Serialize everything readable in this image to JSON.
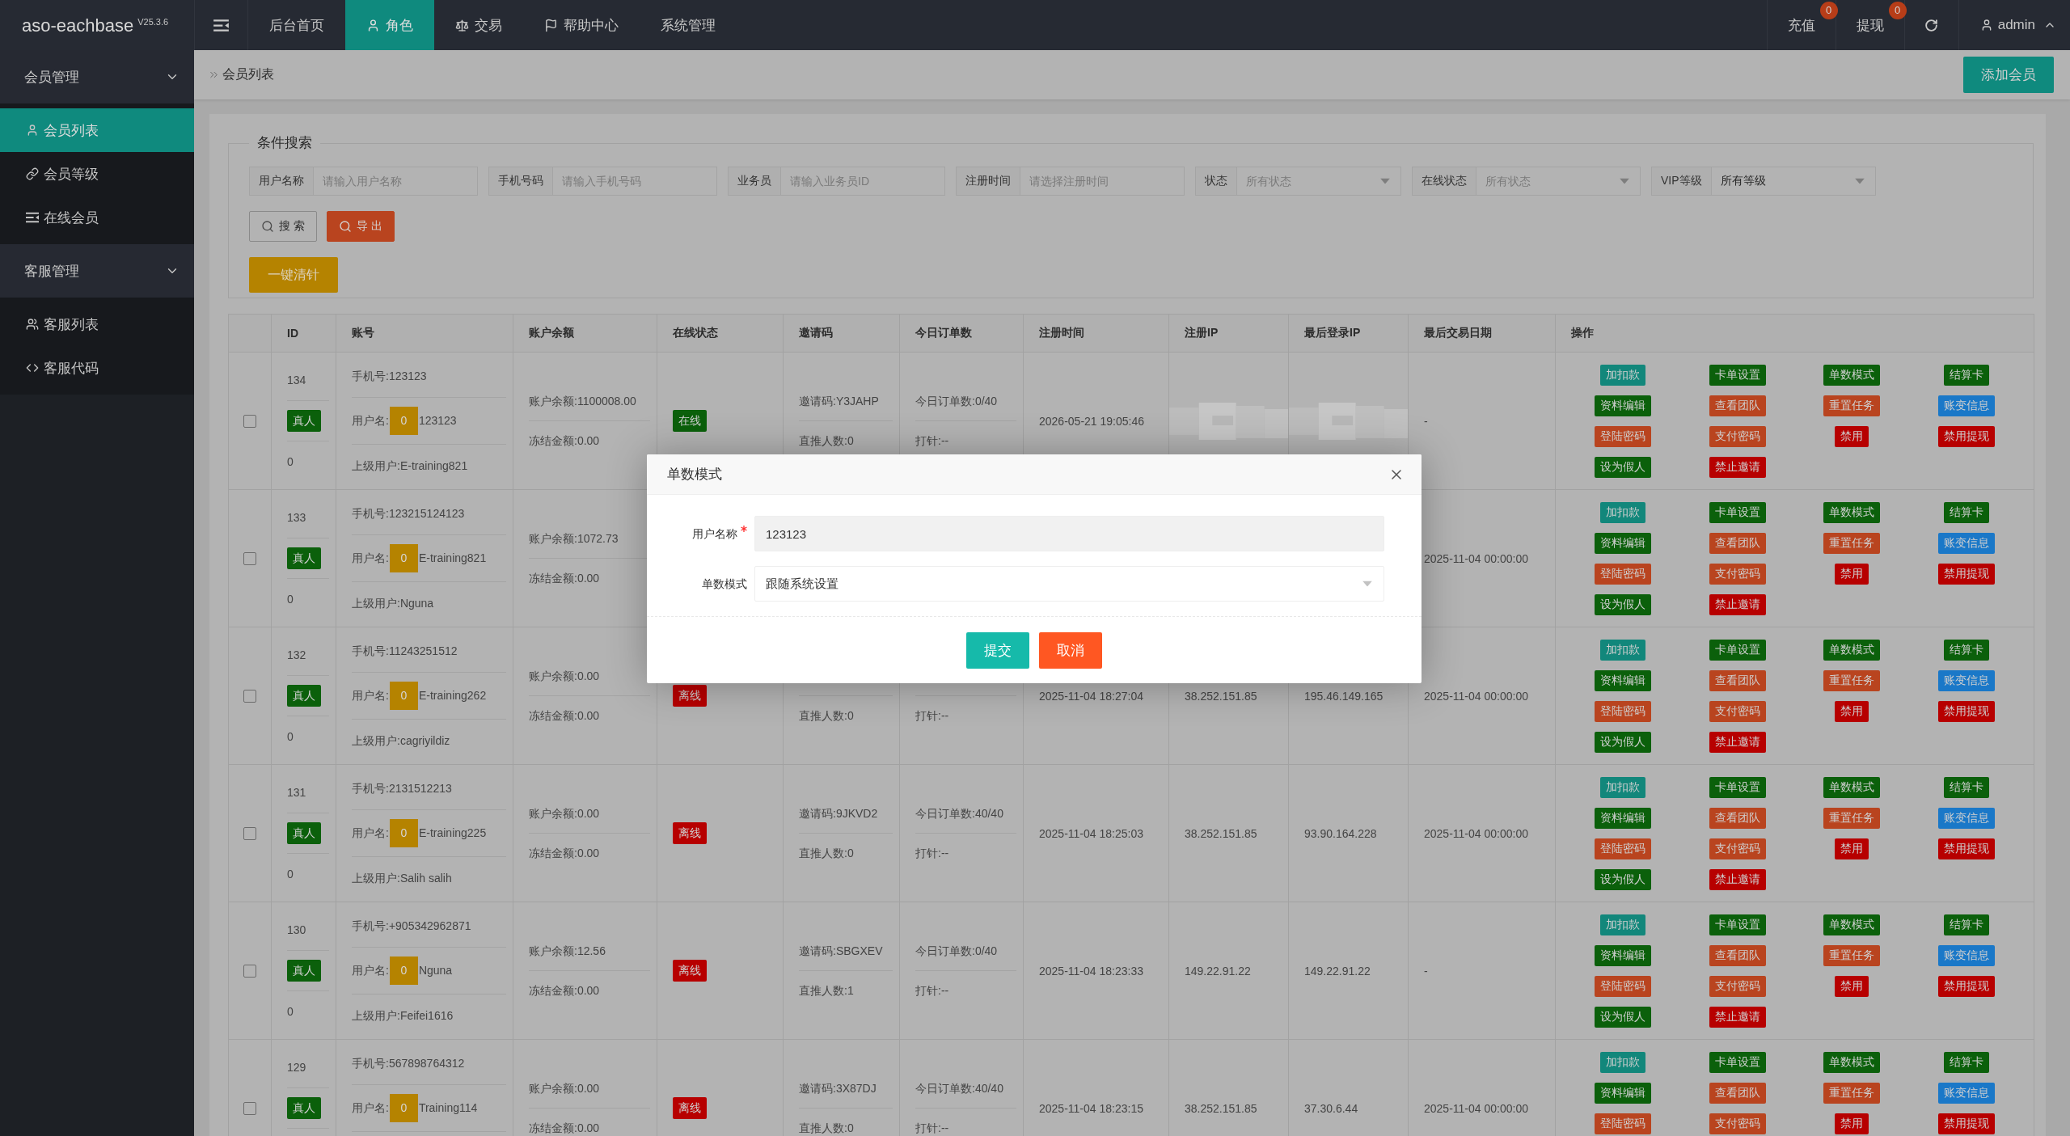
{
  "header": {
    "logo": "aso-eachbase",
    "version": "V25.3.6",
    "nav": [
      {
        "label": "后台首页",
        "selected": false
      },
      {
        "label": "角色",
        "selected": true
      },
      {
        "label": "交易",
        "selected": false
      },
      {
        "label": "帮助中心",
        "selected": false
      },
      {
        "label": "系统管理",
        "selected": false
      }
    ],
    "shortcuts": [
      {
        "label": "充值",
        "badge": "0"
      },
      {
        "label": "提现",
        "badge": "0"
      }
    ],
    "user": "admin"
  },
  "sidebar": {
    "groups": [
      {
        "label": "会员管理",
        "expanded": true,
        "children": [
          {
            "label": "会员列表",
            "selected": true
          },
          {
            "label": "会员等级",
            "selected": false
          },
          {
            "label": "在线会员",
            "selected": false
          }
        ]
      },
      {
        "label": "客服管理",
        "expanded": true,
        "children": [
          {
            "label": "客服列表",
            "selected": false
          },
          {
            "label": "客服代码",
            "selected": false
          }
        ]
      }
    ]
  },
  "breadcrumb": {
    "items": [
      "会员列表"
    ],
    "add_button": "添加会员"
  },
  "search": {
    "legend": "条件搜索",
    "fields": [
      {
        "label": "用户名称",
        "kind": "text",
        "placeholder": "请输入用户名称"
      },
      {
        "label": "手机号码",
        "kind": "text",
        "placeholder": "请输入手机号码"
      },
      {
        "label": "业务员",
        "kind": "text",
        "placeholder": "请输入业务员ID"
      },
      {
        "label": "注册时间",
        "kind": "text",
        "placeholder": "请选择注册时间"
      },
      {
        "label": "状态",
        "kind": "select",
        "placeholder": "所有状态"
      },
      {
        "label": "在线状态",
        "kind": "select",
        "placeholder": "所有状态"
      },
      {
        "label": "VIP等级",
        "kind": "select",
        "value": "所有等级"
      }
    ],
    "buttons": [
      {
        "label": "搜 索",
        "kind": "outline"
      },
      {
        "label": "导 出",
        "kind": "export"
      }
    ],
    "clear_button": "一键清针"
  },
  "table": {
    "columns": [
      "ID",
      "账号",
      "账户余额",
      "在线状态",
      "邀请码",
      "今日订单数",
      "注册时间",
      "注册IP",
      "最后登录IP",
      "最后交易日期",
      "操作"
    ],
    "rows": [
      {
        "checked": false,
        "id": "134",
        "type_tag": "真人",
        "id_sub": "0",
        "phone": "手机号:123123",
        "username_label": "用户名:",
        "username_badge": "0",
        "username": "123123",
        "parent": "上级用户:E-training821",
        "balance": "账户余额:1100008.00",
        "frozen": "冻结金额:0.00",
        "status": {
          "label": "在线",
          "online": true
        },
        "invite": "邀请码:Y3JAHP",
        "direct": "直推人数:0",
        "orders": "今日订单数:0/40",
        "dazhen": "打针:--",
        "reg_time": "2026-05-21 19:05:46",
        "ips_blurred": true,
        "last_trade": "-",
        "actions": [
          {
            "label": "加扣款",
            "color": "#12877b"
          },
          {
            "label": "卡单设置",
            "color": "#0b600b"
          },
          {
            "label": "单数模式",
            "color": "#0b600b"
          },
          {
            "label": "结算卡",
            "color": "#0b600b"
          },
          {
            "label": "资料编辑",
            "color": "#0b600b"
          },
          {
            "label": "查看团队",
            "color": "#b9441f"
          },
          {
            "label": "重置任务",
            "color": "#b9441f"
          },
          {
            "label": "账变信息",
            "color": "#1a78c8"
          },
          {
            "label": "登陆密码",
            "color": "#b9441f"
          },
          {
            "label": "支付密码",
            "color": "#b9441f"
          },
          {
            "label": "禁用",
            "color": "#b70000"
          },
          {
            "label": "禁用提现",
            "color": "#b70000"
          },
          {
            "label": "设为假人",
            "color": "#0b600b"
          },
          {
            "label": "禁止邀请",
            "color": "#b70000"
          }
        ]
      },
      {
        "checked": false,
        "id": "133",
        "type_tag": "真人",
        "id_sub": "0",
        "phone": "手机号:123215124123",
        "username_label": "用户名:",
        "username_badge": "0",
        "username": "E-training821",
        "parent": "上级用户:Nguna",
        "balance": "账户余额:1072.73",
        "frozen": "冻结金额:0.00",
        "last_trade": "2025-11-04 00:00:00",
        "actions": [
          {
            "label": "加扣款",
            "color": "#12877b"
          },
          {
            "label": "卡单设置",
            "color": "#0b600b"
          },
          {
            "label": "单数模式",
            "color": "#0b600b"
          },
          {
            "label": "结算卡",
            "color": "#0b600b"
          },
          {
            "label": "资料编辑",
            "color": "#0b600b"
          },
          {
            "label": "查看团队",
            "color": "#b9441f"
          },
          {
            "label": "重置任务",
            "color": "#b9441f"
          },
          {
            "label": "账变信息",
            "color": "#1a78c8"
          },
          {
            "label": "登陆密码",
            "color": "#b9441f"
          },
          {
            "label": "支付密码",
            "color": "#b9441f"
          },
          {
            "label": "禁用",
            "color": "#b70000"
          },
          {
            "label": "禁用提现",
            "color": "#b70000"
          },
          {
            "label": "设为假人",
            "color": "#0b600b"
          },
          {
            "label": "禁止邀请",
            "color": "#b70000"
          }
        ]
      },
      {
        "checked": false,
        "id": "132",
        "type_tag": "真人",
        "id_sub": "0",
        "phone": "手机号:11243251512",
        "username_label": "用户名:",
        "username_badge": "0",
        "username": "E-training262",
        "parent": "上级用户:cagriyildiz",
        "balance": "账户余额:0.00",
        "frozen": "冻结金额:0.00",
        "status": {
          "label": "离线",
          "online": false
        },
        "direct": "直推人数:0",
        "dazhen": "打针:--",
        "reg_time": "2025-11-04 18:27:04",
        "reg_ip": "38.252.151.85",
        "last_ip": "195.46.149.165",
        "last_trade": "2025-11-04 00:00:00",
        "actions": [
          {
            "label": "加扣款",
            "color": "#12877b"
          },
          {
            "label": "卡单设置",
            "color": "#0b600b"
          },
          {
            "label": "单数模式",
            "color": "#0b600b"
          },
          {
            "label": "结算卡",
            "color": "#0b600b"
          },
          {
            "label": "资料编辑",
            "color": "#0b600b"
          },
          {
            "label": "查看团队",
            "color": "#b9441f"
          },
          {
            "label": "重置任务",
            "color": "#b9441f"
          },
          {
            "label": "账变信息",
            "color": "#1a78c8"
          },
          {
            "label": "登陆密码",
            "color": "#b9441f"
          },
          {
            "label": "支付密码",
            "color": "#b9441f"
          },
          {
            "label": "禁用",
            "color": "#b70000"
          },
          {
            "label": "禁用提现",
            "color": "#b70000"
          },
          {
            "label": "设为假人",
            "color": "#0b600b"
          },
          {
            "label": "禁止邀请",
            "color": "#b70000"
          }
        ]
      },
      {
        "checked": false,
        "id": "131",
        "type_tag": "真人",
        "id_sub": "0",
        "phone": "手机号:2131512213",
        "username_label": "用户名:",
        "username_badge": "0",
        "username": "E-training225",
        "parent": "上级用户:Salih salih",
        "balance": "账户余额:0.00",
        "frozen": "冻结金额:0.00",
        "status": {
          "label": "离线",
          "online": false
        },
        "invite": "邀请码:9JKVD2",
        "direct": "直推人数:0",
        "orders": "今日订单数:40/40",
        "dazhen": "打针:--",
        "reg_time": "2025-11-04 18:25:03",
        "reg_ip": "38.252.151.85",
        "last_ip": "93.90.164.228",
        "last_trade": "2025-11-04 00:00:00",
        "actions": [
          {
            "label": "加扣款",
            "color": "#12877b"
          },
          {
            "label": "卡单设置",
            "color": "#0b600b"
          },
          {
            "label": "单数模式",
            "color": "#0b600b"
          },
          {
            "label": "结算卡",
            "color": "#0b600b"
          },
          {
            "label": "资料编辑",
            "color": "#0b600b"
          },
          {
            "label": "查看团队",
            "color": "#b9441f"
          },
          {
            "label": "重置任务",
            "color": "#b9441f"
          },
          {
            "label": "账变信息",
            "color": "#1a78c8"
          },
          {
            "label": "登陆密码",
            "color": "#b9441f"
          },
          {
            "label": "支付密码",
            "color": "#b9441f"
          },
          {
            "label": "禁用",
            "color": "#b70000"
          },
          {
            "label": "禁用提现",
            "color": "#b70000"
          },
          {
            "label": "设为假人",
            "color": "#0b600b"
          },
          {
            "label": "禁止邀请",
            "color": "#b70000"
          }
        ]
      },
      {
        "checked": false,
        "id": "130",
        "type_tag": "真人",
        "id_sub": "0",
        "phone": "手机号:+905342962871",
        "username_label": "用户名:",
        "username_badge": "0",
        "username": "Nguna",
        "parent": "上级用户:Feifei1616",
        "balance": "账户余额:12.56",
        "frozen": "冻结金额:0.00",
        "status": {
          "label": "离线",
          "online": false
        },
        "invite": "邀请码:SBGXEV",
        "direct": "直推人数:1",
        "orders": "今日订单数:0/40",
        "dazhen": "打针:--",
        "reg_time": "2025-11-04 18:23:33",
        "reg_ip": "149.22.91.22",
        "last_ip": "149.22.91.22",
        "last_trade": "-",
        "actions": [
          {
            "label": "加扣款",
            "color": "#12877b"
          },
          {
            "label": "卡单设置",
            "color": "#0b600b"
          },
          {
            "label": "单数模式",
            "color": "#0b600b"
          },
          {
            "label": "结算卡",
            "color": "#0b600b"
          },
          {
            "label": "资料编辑",
            "color": "#0b600b"
          },
          {
            "label": "查看团队",
            "color": "#b9441f"
          },
          {
            "label": "重置任务",
            "color": "#b9441f"
          },
          {
            "label": "账变信息",
            "color": "#1a78c8"
          },
          {
            "label": "登陆密码",
            "color": "#b9441f"
          },
          {
            "label": "支付密码",
            "color": "#b9441f"
          },
          {
            "label": "禁用",
            "color": "#b70000"
          },
          {
            "label": "禁用提现",
            "color": "#b70000"
          },
          {
            "label": "设为假人",
            "color": "#0b600b"
          },
          {
            "label": "禁止邀请",
            "color": "#b70000"
          }
        ]
      },
      {
        "checked": false,
        "id": "129",
        "type_tag": "真人",
        "phone": "手机号:567898764312",
        "username_label": "用户名:",
        "username_badge": "0",
        "username": "Training114",
        "balance": "账户余额:0.00",
        "frozen": "冻结金额:0.00",
        "status": {
          "label": "离线",
          "online": false
        },
        "invite": "邀请码:3X87DJ",
        "direct": "直推人数:0",
        "orders": "今日订单数:40/40",
        "dazhen": "打针:--",
        "reg_time": "2025-11-04 18:23:15",
        "reg_ip": "38.252.151.85",
        "last_ip": "37.30.6.44",
        "last_trade": "2025-11-04 00:00:00",
        "actions": [
          {
            "label": "加扣款",
            "color": "#12877b"
          },
          {
            "label": "卡单设置",
            "color": "#0b600b"
          },
          {
            "label": "单数模式",
            "color": "#0b600b"
          },
          {
            "label": "结算卡",
            "color": "#0b600b"
          },
          {
            "label": "资料编辑",
            "color": "#0b600b"
          },
          {
            "label": "查看团队",
            "color": "#b9441f"
          },
          {
            "label": "重置任务",
            "color": "#b9441f"
          },
          {
            "label": "账变信息",
            "color": "#1a78c8"
          },
          {
            "label": "登陆密码",
            "color": "#b9441f"
          },
          {
            "label": "支付密码",
            "color": "#b9441f"
          },
          {
            "label": "禁用",
            "color": "#b70000"
          },
          {
            "label": "禁用提现",
            "color": "#b70000"
          }
        ]
      }
    ]
  },
  "modal": {
    "title": "单数模式",
    "fields": [
      {
        "label": "用户名称",
        "kind": "text",
        "value": "123123",
        "required": true,
        "readonly": true
      },
      {
        "label": "单数模式",
        "kind": "select",
        "value": "跟随系统设置",
        "required": false,
        "readonly": false
      }
    ],
    "buttons": [
      {
        "label": "提交",
        "kind": "primary"
      },
      {
        "label": "取消",
        "kind": "danger"
      }
    ]
  }
}
